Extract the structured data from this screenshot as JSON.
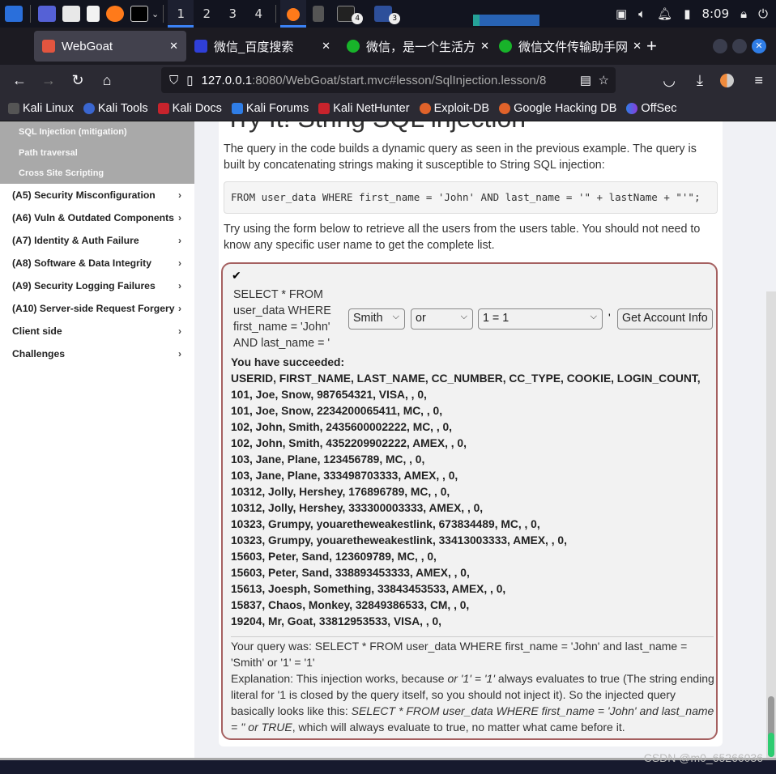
{
  "taskbar": {
    "workspaces": [
      "1",
      "2",
      "3",
      "4"
    ],
    "badges": [
      "4",
      "3"
    ],
    "clock": "8:09"
  },
  "browser": {
    "tabs": [
      {
        "label": "WebGoat",
        "color": "#e2553f"
      },
      {
        "label": "微信_百度搜索",
        "color": "#2f3fd8"
      },
      {
        "label": "微信，是一个生活方",
        "color": "#18b32a"
      },
      {
        "label": "微信文件传输助手网",
        "color": "#18b32a"
      }
    ],
    "new_tab": "+",
    "url_host": "127.0.0.1",
    "url_rest": ":8080/WebGoat/start.mvc#lesson/SqlInjection.lesson/8",
    "bookmarks": [
      "Kali Linux",
      "Kali Tools",
      "Kali Docs",
      "Kali Forums",
      "Kali NetHunter",
      "Exploit-DB",
      "Google Hacking DB",
      "OffSec"
    ]
  },
  "sidebar": {
    "subitems": [
      "SQL Injection (mitigation)",
      "Path traversal",
      "Cross Site Scripting"
    ],
    "categories": [
      "(A5) Security Misconfiguration",
      "(A6) Vuln & Outdated Components",
      "(A7) Identity & Auth Failure",
      "(A8) Software & Data Integrity",
      "(A9) Security Logging Failures",
      "(A10) Server-side Request Forgery",
      "Client side",
      "Challenges"
    ]
  },
  "lesson": {
    "title": "Try It! String SQL injection",
    "intro": "The query in the code builds a dynamic query as seen in the previous example. The query is built by concatenating strings making it susceptible to String SQL injection:",
    "code": "FROM user_data WHERE first_name = 'John' AND last_name = '\" + lastName + \"'\";",
    "instructions": "Try using the form below to retrieve all the users from the users table. You should not need to know any specific user name to get the complete list.",
    "query_prefix": "SELECT * FROM user_data WHERE first_name = 'John' AND last_name = '",
    "select1": "Smith",
    "select2": "or",
    "select3": "1 = 1",
    "quote": "'",
    "submit": "Get Account Info",
    "success": "You have succeeded:",
    "results": [
      "USERID, FIRST_NAME, LAST_NAME, CC_NUMBER, CC_TYPE, COOKIE, LOGIN_COUNT,",
      "101, Joe, Snow, 987654321, VISA, , 0,",
      "101, Joe, Snow, 2234200065411, MC, , 0,",
      "102, John, Smith, 2435600002222, MC, , 0,",
      "102, John, Smith, 4352209902222, AMEX, , 0,",
      "103, Jane, Plane, 123456789, MC, , 0,",
      "103, Jane, Plane, 333498703333, AMEX, , 0,",
      "10312, Jolly, Hershey, 176896789, MC, , 0,",
      "10312, Jolly, Hershey, 333300003333, AMEX, , 0,",
      "10323, Grumpy, youaretheweakestlink, 673834489, MC, , 0,",
      "10323, Grumpy, youaretheweakestlink, 33413003333, AMEX, , 0,",
      "15603, Peter, Sand, 123609789, MC, , 0,",
      "15603, Peter, Sand, 338893453333, AMEX, , 0,",
      "15613, Joesph, Something, 33843453533, AMEX, , 0,",
      "15837, Chaos, Monkey, 32849386533, CM, , 0,",
      "19204, Mr, Goat, 33812953533, VISA, , 0,"
    ],
    "your_query": "Your query was: SELECT * FROM user_data WHERE first_name = 'John' and last_name = 'Smith' or '1' = '1'",
    "expl_1": "Explanation: This injection works, because ",
    "expl_2": "or '1' = '1'",
    "expl_3": " always evaluates to true (The string ending literal for '1 is closed by the query itself, so you should not inject it). So the injected query basically looks like this: ",
    "expl_4": "SELECT * FROM user_data WHERE first_name = 'John' and last_name = '' or TRUE",
    "expl_5": ", which will always evaluate to true, no matter what came before it."
  },
  "watermark": "CSDN @m0_65266036"
}
